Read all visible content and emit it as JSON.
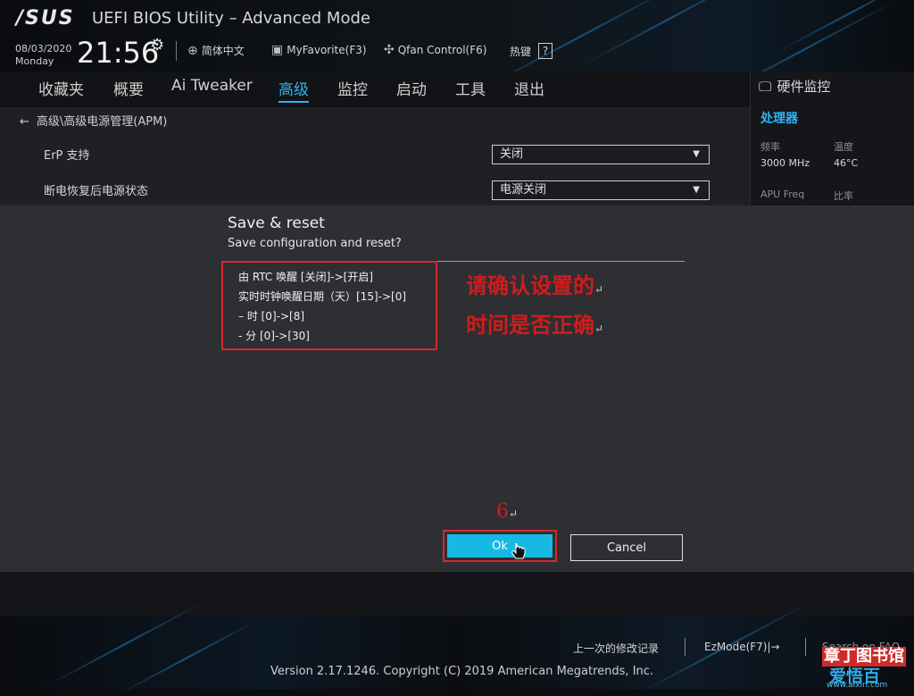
{
  "header": {
    "logo": "/SUS",
    "title": "UEFI BIOS Utility – Advanced Mode",
    "date": "08/03/2020",
    "day": "Monday",
    "time": "21:56",
    "language": "简体中文",
    "myfavorite": "MyFavorite(F3)",
    "qfan": "Qfan Control(F6)",
    "hotkeys": "热键",
    "hotkeys_icon": "?"
  },
  "nav": {
    "items": [
      "收藏夹",
      "概要",
      "Ai Tweaker",
      "高级",
      "监控",
      "启动",
      "工具",
      "退出"
    ],
    "active_index": 3
  },
  "main": {
    "breadcrumb": "高级\\高级电源管理(APM)",
    "rows": [
      {
        "label": "ErP 支持",
        "value": "关闭"
      },
      {
        "label": "断电恢复后电源状态",
        "value": "电源关闭"
      }
    ]
  },
  "hw_monitor": {
    "title": "硬件监控",
    "section": "处理器",
    "freq_label": "频率",
    "temp_label": "温度",
    "freq_value": "3000 MHz",
    "temp_value": "46°C",
    "apu_label": "APU Freq",
    "ratio_label": "比率"
  },
  "dialog": {
    "title": "Save & reset",
    "subtitle": "Save configuration and reset?",
    "changes": [
      "由 RTC 唤醒 [关闭]->[开启]",
      "实时时钟唤醒日期（天）[15]->[0]",
      "– 时 [0]->[8]",
      "- 分 [0]->[30]"
    ],
    "ok_label": "Ok",
    "cancel_label": "Cancel"
  },
  "annotation": {
    "line1": "请确认设置的",
    "line2": "时间是否正确",
    "return_mark": "↵",
    "step": "6",
    "step_mark": "↵"
  },
  "footer": {
    "last_changes": "上一次的修改记录",
    "ezmode": "EzMode(F7)|→",
    "search": "Search on FAQ",
    "version": "Version 2.17.1246. Copyright (C) 2019 American Megatrends, Inc."
  },
  "watermark": {
    "line1": "章丁图书馆",
    "line2": "爱悟百",
    "url": "www.aixiri.com"
  },
  "colors": {
    "accent": "#2fb4f0",
    "ok_button": "#15b9e3",
    "annotation_red": "#d01c1c"
  }
}
